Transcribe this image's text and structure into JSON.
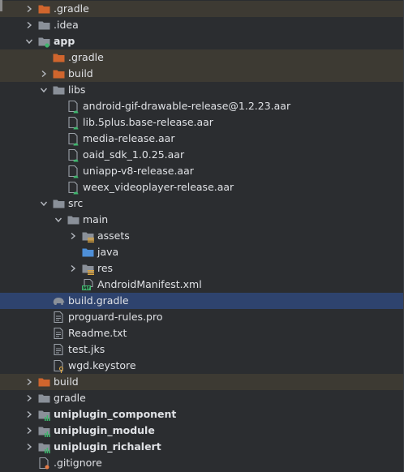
{
  "colors": {
    "background": "#2b2d30",
    "selection": "#2e436e",
    "excluded_row": "#3d3a33",
    "folder_plain": "#8a9099",
    "folder_excluded": "#d0652d",
    "folder_source": "#4e8fd8",
    "module_badge": "#3fb56d",
    "text": "#dfe1e5"
  },
  "tree": {
    "items": [
      {
        "label": ".gradle",
        "indent": 0,
        "chevron": "right",
        "icon": "folder-excluded",
        "excluded": true
      },
      {
        "label": ".idea",
        "indent": 0,
        "chevron": "right",
        "icon": "folder"
      },
      {
        "label": "app",
        "indent": 0,
        "chevron": "down",
        "icon": "module-folder",
        "bold": true
      },
      {
        "label": ".gradle",
        "indent": 1,
        "chevron": "none",
        "icon": "folder-excluded",
        "excluded": true
      },
      {
        "label": "build",
        "indent": 1,
        "chevron": "right",
        "icon": "folder-excluded",
        "excluded": true
      },
      {
        "label": "libs",
        "indent": 1,
        "chevron": "down",
        "icon": "folder"
      },
      {
        "label": "android-gif-drawable-release@1.2.23.aar",
        "indent": 2,
        "chevron": "none",
        "icon": "aar-file"
      },
      {
        "label": "lib.5plus.base-release.aar",
        "indent": 2,
        "chevron": "none",
        "icon": "aar-file"
      },
      {
        "label": "media-release.aar",
        "indent": 2,
        "chevron": "none",
        "icon": "aar-file"
      },
      {
        "label": "oaid_sdk_1.0.25.aar",
        "indent": 2,
        "chevron": "none",
        "icon": "aar-file"
      },
      {
        "label": "uniapp-v8-release.aar",
        "indent": 2,
        "chevron": "none",
        "icon": "aar-file"
      },
      {
        "label": "weex_videoplayer-release.aar",
        "indent": 2,
        "chevron": "none",
        "icon": "aar-file"
      },
      {
        "label": "src",
        "indent": 1,
        "chevron": "down",
        "icon": "folder"
      },
      {
        "label": "main",
        "indent": 2,
        "chevron": "down",
        "icon": "folder"
      },
      {
        "label": "assets",
        "indent": 3,
        "chevron": "right",
        "icon": "resources-folder"
      },
      {
        "label": "java",
        "indent": 3,
        "chevron": "none",
        "icon": "source-folder"
      },
      {
        "label": "res",
        "indent": 3,
        "chevron": "right",
        "icon": "resources-folder"
      },
      {
        "label": "AndroidManifest.xml",
        "indent": 3,
        "chevron": "none",
        "icon": "manifest-file"
      },
      {
        "label": "build.gradle",
        "indent": 1,
        "chevron": "none",
        "icon": "gradle-elephant",
        "selected": true
      },
      {
        "label": "proguard-rules.pro",
        "indent": 1,
        "chevron": "none",
        "icon": "text-file"
      },
      {
        "label": "Readme.txt",
        "indent": 1,
        "chevron": "none",
        "icon": "text-file"
      },
      {
        "label": "test.jks",
        "indent": 1,
        "chevron": "none",
        "icon": "text-file"
      },
      {
        "label": "wgd.keystore",
        "indent": 1,
        "chevron": "none",
        "icon": "keystore-file"
      },
      {
        "label": "build",
        "indent": 0,
        "chevron": "right",
        "icon": "folder-excluded",
        "excluded": true
      },
      {
        "label": "gradle",
        "indent": 0,
        "chevron": "right",
        "icon": "folder"
      },
      {
        "label": "uniplugin_component",
        "indent": 0,
        "chevron": "right",
        "icon": "library-module",
        "bold": true
      },
      {
        "label": "uniplugin_module",
        "indent": 0,
        "chevron": "right",
        "icon": "library-module",
        "bold": true
      },
      {
        "label": "uniplugin_richalert",
        "indent": 0,
        "chevron": "right",
        "icon": "library-module",
        "bold": true
      },
      {
        "label": ".gitignore",
        "indent": 0,
        "chevron": "none",
        "icon": "gitignore-file"
      }
    ]
  }
}
